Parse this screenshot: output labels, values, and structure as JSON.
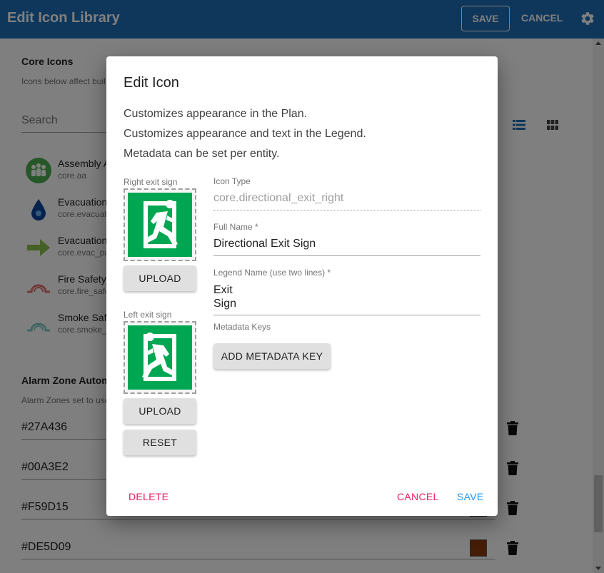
{
  "appbar": {
    "title": "Edit Icon Library",
    "save_label": "SAVE",
    "cancel_label": "CANCEL",
    "settings_icon": "gear-icon",
    "color": "#1e6fb8"
  },
  "core_icons": {
    "title": "Core Icons",
    "subtitle": "Icons below affect buil",
    "search_placeholder": "Search",
    "items": [
      {
        "name": "Assembly A",
        "id": "core.aa",
        "icon": "assembly-area-icon"
      },
      {
        "name": "Evacuation",
        "id": "core.evacuat",
        "icon": "evacuation-point-icon"
      },
      {
        "name": "Evacuation",
        "id": "core.evac_pa",
        "icon": "evacuation-path-arrow-icon"
      },
      {
        "name": "Fire Safety",
        "id": "core.fire_safe",
        "icon": "fire-safety-icon"
      },
      {
        "name": "Smoke Saf",
        "id": "core.smoke_",
        "icon": "smoke-safety-icon"
      }
    ]
  },
  "alarm_zones": {
    "title": "Alarm Zone Autom",
    "subtitle": "Alarm Zones set to use",
    "colors": [
      {
        "hex": "#27A436",
        "swatch": "#27A436"
      },
      {
        "hex": "#00A3E2",
        "swatch": "#00A3E2"
      },
      {
        "hex": "#F59D15",
        "swatch": "#F59D15"
      },
      {
        "hex": "#DE5D09",
        "swatch": "#8B3A0E"
      }
    ]
  },
  "dialog": {
    "title": "Edit Icon",
    "descriptions": [
      "Customizes appearance in the Plan.",
      "Customizes appearance and text in the Legend.",
      "Metadata can be set per entity."
    ],
    "right_label": "Right exit sign",
    "left_label": "Left exit sign",
    "upload_label": "UPLOAD",
    "reset_label": "RESET",
    "icon_type_label": "Icon Type",
    "icon_type_value": "core.directional_exit_right",
    "full_name_label": "Full Name *",
    "full_name_value": "Directional Exit Sign",
    "legend_name_label": "Legend Name (use two lines) *",
    "legend_name_line1": "Exit",
    "legend_name_line2": "Sign",
    "metadata_label": "Metadata Keys",
    "add_metadata_label": "ADD METADATA KEY",
    "delete_label": "DELETE",
    "cancel_label": "CANCEL",
    "save_label": "SAVE",
    "exit_sign_color": "#00a651"
  }
}
